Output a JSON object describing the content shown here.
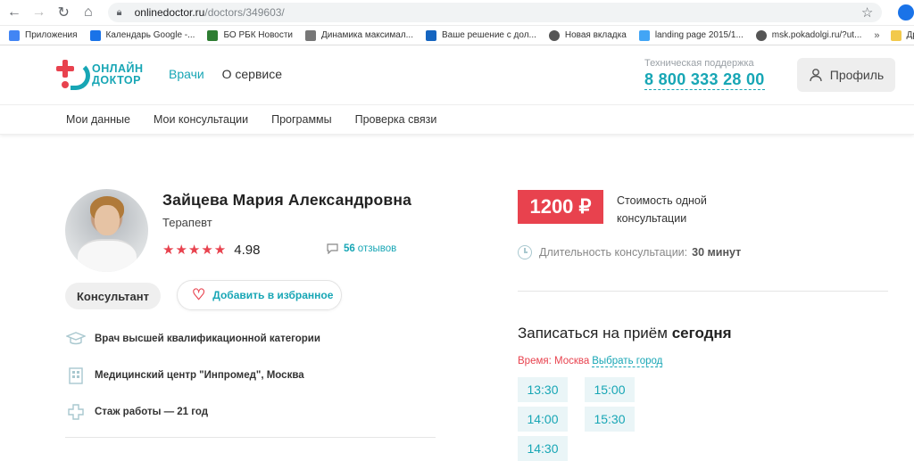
{
  "browser": {
    "url_host": "onlinedoctor.ru",
    "url_path": "/doctors/349603/",
    "bookmarks": [
      {
        "label": "Приложения",
        "color": "#4285f4"
      },
      {
        "label": "Календарь Google -...",
        "color": "#1a73e8"
      },
      {
        "label": "БО РБК Новости",
        "color": "#2e7d32"
      },
      {
        "label": "Динамика максимал...",
        "color": "#777777"
      },
      {
        "label": "Ваше решение с дол...",
        "color": "#1565c0"
      },
      {
        "label": "Новая вкладка",
        "color": "#555555"
      },
      {
        "label": "landing page 2015/1...",
        "color": "#42a5f5"
      },
      {
        "label": "msk.pokadolgi.ru/?ut...",
        "color": "#555555"
      }
    ],
    "bookmarks_more": "»",
    "other_bookmarks": "Друг"
  },
  "header": {
    "logo_line1": "ОНЛАЙН",
    "logo_line2": "ДОКТОР",
    "nav_doctors": "Врачи",
    "nav_about": "О сервисе",
    "support_label": "Техническая поддержка",
    "support_phone": "8 800 333 28 00",
    "profile_label": "Профиль"
  },
  "subnav": {
    "items": [
      "Мои данные",
      "Мои консультации",
      "Программы",
      "Проверка связи"
    ]
  },
  "doctor": {
    "name": "Зайцева Мария Александровна",
    "specialty": "Терапевт",
    "stars": "★★★★★",
    "rating": "4.98",
    "reviews_count": "56",
    "reviews_label": "отзывов",
    "badge": "Консультант",
    "favorite_label": "Добавить в избранное",
    "info": [
      "Врач высшей квалификационной категории",
      "Медицинский центр \"Инпромед\", Москва",
      "Стаж работы — 21 год"
    ]
  },
  "booking": {
    "price": "1200 ₽",
    "price_desc": "Стоимость одной консультации",
    "duration_label": "Длительность консультации:",
    "duration_value": "30 минут",
    "title_prefix": "Записаться на приём",
    "title_day": "сегодня",
    "tz_label": "Время: Москва",
    "tz_link": "Выбрать город",
    "slots": [
      "13:30",
      "15:00",
      "14:00",
      "15:30",
      "14:30"
    ]
  },
  "colors": {
    "accent": "#17a6b5",
    "brand_red": "#e8424e"
  }
}
